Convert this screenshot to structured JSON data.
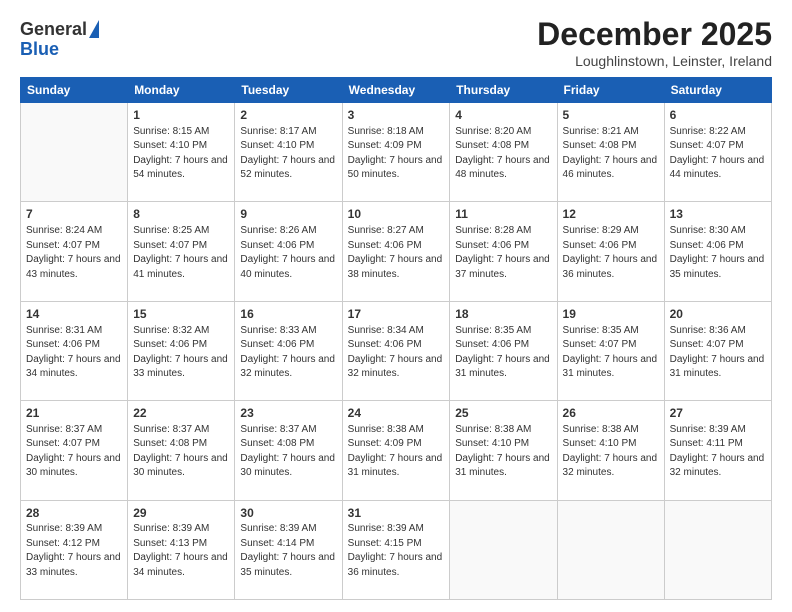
{
  "logo": {
    "line1": "General",
    "line2": "Blue"
  },
  "title": "December 2025",
  "location": "Loughlinstown, Leinster, Ireland",
  "days_header": [
    "Sunday",
    "Monday",
    "Tuesday",
    "Wednesday",
    "Thursday",
    "Friday",
    "Saturday"
  ],
  "weeks": [
    [
      {
        "day": "",
        "sunrise": "",
        "sunset": "",
        "daylight": ""
      },
      {
        "day": "1",
        "sunrise": "Sunrise: 8:15 AM",
        "sunset": "Sunset: 4:10 PM",
        "daylight": "Daylight: 7 hours and 54 minutes."
      },
      {
        "day": "2",
        "sunrise": "Sunrise: 8:17 AM",
        "sunset": "Sunset: 4:10 PM",
        "daylight": "Daylight: 7 hours and 52 minutes."
      },
      {
        "day": "3",
        "sunrise": "Sunrise: 8:18 AM",
        "sunset": "Sunset: 4:09 PM",
        "daylight": "Daylight: 7 hours and 50 minutes."
      },
      {
        "day": "4",
        "sunrise": "Sunrise: 8:20 AM",
        "sunset": "Sunset: 4:08 PM",
        "daylight": "Daylight: 7 hours and 48 minutes."
      },
      {
        "day": "5",
        "sunrise": "Sunrise: 8:21 AM",
        "sunset": "Sunset: 4:08 PM",
        "daylight": "Daylight: 7 hours and 46 minutes."
      },
      {
        "day": "6",
        "sunrise": "Sunrise: 8:22 AM",
        "sunset": "Sunset: 4:07 PM",
        "daylight": "Daylight: 7 hours and 44 minutes."
      }
    ],
    [
      {
        "day": "7",
        "sunrise": "Sunrise: 8:24 AM",
        "sunset": "Sunset: 4:07 PM",
        "daylight": "Daylight: 7 hours and 43 minutes."
      },
      {
        "day": "8",
        "sunrise": "Sunrise: 8:25 AM",
        "sunset": "Sunset: 4:07 PM",
        "daylight": "Daylight: 7 hours and 41 minutes."
      },
      {
        "day": "9",
        "sunrise": "Sunrise: 8:26 AM",
        "sunset": "Sunset: 4:06 PM",
        "daylight": "Daylight: 7 hours and 40 minutes."
      },
      {
        "day": "10",
        "sunrise": "Sunrise: 8:27 AM",
        "sunset": "Sunset: 4:06 PM",
        "daylight": "Daylight: 7 hours and 38 minutes."
      },
      {
        "day": "11",
        "sunrise": "Sunrise: 8:28 AM",
        "sunset": "Sunset: 4:06 PM",
        "daylight": "Daylight: 7 hours and 37 minutes."
      },
      {
        "day": "12",
        "sunrise": "Sunrise: 8:29 AM",
        "sunset": "Sunset: 4:06 PM",
        "daylight": "Daylight: 7 hours and 36 minutes."
      },
      {
        "day": "13",
        "sunrise": "Sunrise: 8:30 AM",
        "sunset": "Sunset: 4:06 PM",
        "daylight": "Daylight: 7 hours and 35 minutes."
      }
    ],
    [
      {
        "day": "14",
        "sunrise": "Sunrise: 8:31 AM",
        "sunset": "Sunset: 4:06 PM",
        "daylight": "Daylight: 7 hours and 34 minutes."
      },
      {
        "day": "15",
        "sunrise": "Sunrise: 8:32 AM",
        "sunset": "Sunset: 4:06 PM",
        "daylight": "Daylight: 7 hours and 33 minutes."
      },
      {
        "day": "16",
        "sunrise": "Sunrise: 8:33 AM",
        "sunset": "Sunset: 4:06 PM",
        "daylight": "Daylight: 7 hours and 32 minutes."
      },
      {
        "day": "17",
        "sunrise": "Sunrise: 8:34 AM",
        "sunset": "Sunset: 4:06 PM",
        "daylight": "Daylight: 7 hours and 32 minutes."
      },
      {
        "day": "18",
        "sunrise": "Sunrise: 8:35 AM",
        "sunset": "Sunset: 4:06 PM",
        "daylight": "Daylight: 7 hours and 31 minutes."
      },
      {
        "day": "19",
        "sunrise": "Sunrise: 8:35 AM",
        "sunset": "Sunset: 4:07 PM",
        "daylight": "Daylight: 7 hours and 31 minutes."
      },
      {
        "day": "20",
        "sunrise": "Sunrise: 8:36 AM",
        "sunset": "Sunset: 4:07 PM",
        "daylight": "Daylight: 7 hours and 31 minutes."
      }
    ],
    [
      {
        "day": "21",
        "sunrise": "Sunrise: 8:37 AM",
        "sunset": "Sunset: 4:07 PM",
        "daylight": "Daylight: 7 hours and 30 minutes."
      },
      {
        "day": "22",
        "sunrise": "Sunrise: 8:37 AM",
        "sunset": "Sunset: 4:08 PM",
        "daylight": "Daylight: 7 hours and 30 minutes."
      },
      {
        "day": "23",
        "sunrise": "Sunrise: 8:37 AM",
        "sunset": "Sunset: 4:08 PM",
        "daylight": "Daylight: 7 hours and 30 minutes."
      },
      {
        "day": "24",
        "sunrise": "Sunrise: 8:38 AM",
        "sunset": "Sunset: 4:09 PM",
        "daylight": "Daylight: 7 hours and 31 minutes."
      },
      {
        "day": "25",
        "sunrise": "Sunrise: 8:38 AM",
        "sunset": "Sunset: 4:10 PM",
        "daylight": "Daylight: 7 hours and 31 minutes."
      },
      {
        "day": "26",
        "sunrise": "Sunrise: 8:38 AM",
        "sunset": "Sunset: 4:10 PM",
        "daylight": "Daylight: 7 hours and 32 minutes."
      },
      {
        "day": "27",
        "sunrise": "Sunrise: 8:39 AM",
        "sunset": "Sunset: 4:11 PM",
        "daylight": "Daylight: 7 hours and 32 minutes."
      }
    ],
    [
      {
        "day": "28",
        "sunrise": "Sunrise: 8:39 AM",
        "sunset": "Sunset: 4:12 PM",
        "daylight": "Daylight: 7 hours and 33 minutes."
      },
      {
        "day": "29",
        "sunrise": "Sunrise: 8:39 AM",
        "sunset": "Sunset: 4:13 PM",
        "daylight": "Daylight: 7 hours and 34 minutes."
      },
      {
        "day": "30",
        "sunrise": "Sunrise: 8:39 AM",
        "sunset": "Sunset: 4:14 PM",
        "daylight": "Daylight: 7 hours and 35 minutes."
      },
      {
        "day": "31",
        "sunrise": "Sunrise: 8:39 AM",
        "sunset": "Sunset: 4:15 PM",
        "daylight": "Daylight: 7 hours and 36 minutes."
      },
      {
        "day": "",
        "sunrise": "",
        "sunset": "",
        "daylight": ""
      },
      {
        "day": "",
        "sunrise": "",
        "sunset": "",
        "daylight": ""
      },
      {
        "day": "",
        "sunrise": "",
        "sunset": "",
        "daylight": ""
      }
    ]
  ]
}
